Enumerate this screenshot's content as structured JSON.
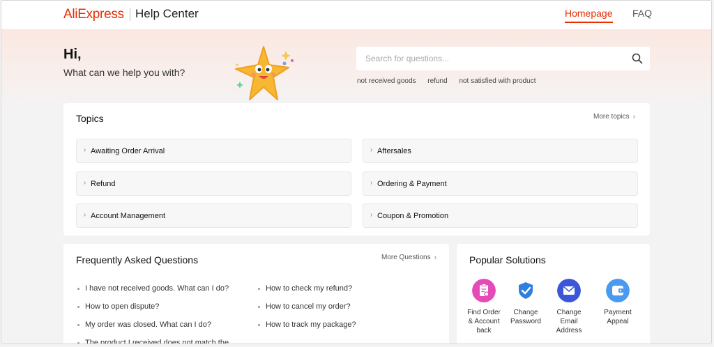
{
  "header": {
    "logo": "AliExpress",
    "subtitle": "Help Center",
    "nav": {
      "homepage": "Homepage",
      "faq": "FAQ"
    }
  },
  "hero": {
    "greeting": "Hi,",
    "prompt": "What can we help you with?",
    "search_placeholder": "Search for questions...",
    "chips": [
      "not received goods",
      "refund",
      "not satisfied with product"
    ]
  },
  "topics": {
    "title": "Topics",
    "more": "More topics",
    "items": [
      "Awaiting Order Arrival",
      "Aftersales",
      "Refund",
      "Ordering & Payment",
      "Account Management",
      "Coupon & Promotion"
    ]
  },
  "faq": {
    "title": "Frequently Asked Questions",
    "more": "More Questions",
    "left": [
      "I have not received goods. What can I do?",
      "How to open dispute?",
      "My order was closed. What can I do?",
      "The product I received does not match the"
    ],
    "right": [
      "How to check my refund?",
      "How to cancel my order?",
      "How to track my package?"
    ]
  },
  "popular": {
    "title": "Popular Solutions",
    "items": [
      {
        "label": "Find Order & Account back",
        "icon": "clipboard-search-icon",
        "color": "#e54bb7"
      },
      {
        "label": "Change Password",
        "icon": "shield-check-icon",
        "color": "#2f7fe0"
      },
      {
        "label": "Change Email Address",
        "icon": "envelope-icon",
        "color": "#3b56d9"
      },
      {
        "label": "Payment Appeal",
        "icon": "wallet-icon",
        "color": "#4a9bf0"
      }
    ]
  },
  "colors": {
    "brand": "#e62e04"
  }
}
